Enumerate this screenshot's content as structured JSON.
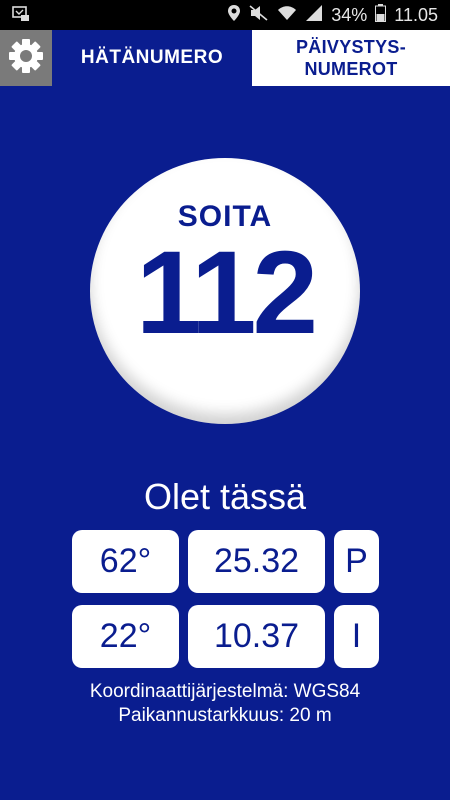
{
  "status_bar": {
    "battery_percent": "34%",
    "time": "11.05",
    "icons": [
      "notification-icon",
      "location-icon",
      "mute-icon",
      "wifi-icon",
      "signal-icon",
      "battery-icon"
    ]
  },
  "header": {
    "settings_icon": "gear-icon",
    "tab_emergency": "HÄTÄNUMERO",
    "tab_duty_line1": "PÄIVYSTYS-",
    "tab_duty_line2": "NUMEROT"
  },
  "call": {
    "label": "SOITA",
    "number": "112"
  },
  "location": {
    "title": "Olet tässä",
    "latitude": {
      "deg": "62°",
      "min": "25.32",
      "hemisphere": "P"
    },
    "longitude": {
      "deg": "22°",
      "min": "10.37",
      "hemisphere": "I"
    },
    "coordinate_system": "Koordinaattijärjestelmä: WGS84",
    "accuracy": "Paikannustarkkuus: 20 m"
  },
  "colors": {
    "background": "#0a1d8f",
    "accent_white": "#ffffff",
    "settings_bg": "#7a7a7a"
  }
}
